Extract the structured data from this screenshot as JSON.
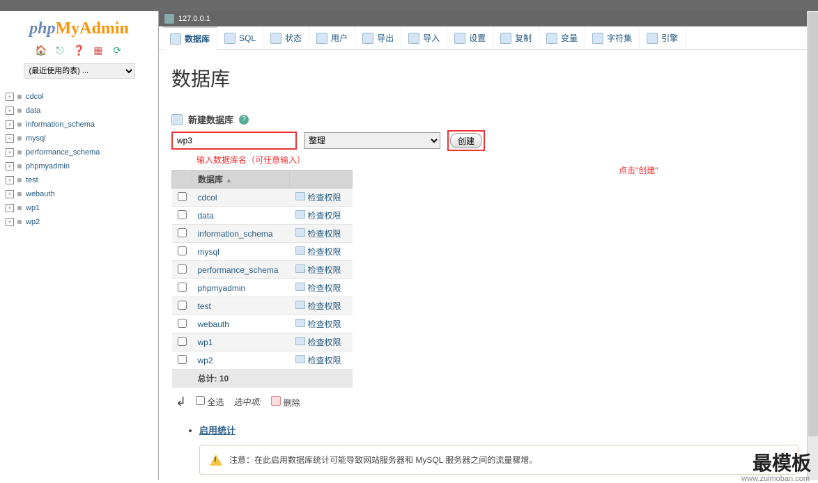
{
  "breadcrumb": {
    "server": "127.0.0.1"
  },
  "sidebar": {
    "recent_placeholder": "(最近使用的表) ...",
    "dbs": [
      "cdcol",
      "data",
      "information_schema",
      "mysql",
      "performance_schema",
      "phpmyadmin",
      "test",
      "webauth",
      "wp1",
      "wp2"
    ]
  },
  "tabs": [
    "数据库",
    "SQL",
    "状态",
    "用户",
    "导出",
    "导入",
    "设置",
    "复制",
    "变量",
    "字符集",
    "引擎"
  ],
  "page_title": "数据库",
  "create": {
    "label": "新建数据库",
    "input_value": "wp3",
    "collation_placeholder": "整理",
    "button": "创建"
  },
  "annotations": {
    "input": "输入数据库名（可任意输入）",
    "button": "点击\"创建\""
  },
  "table": {
    "header": {
      "db": "数据库"
    },
    "rows": [
      {
        "name": "cdcol",
        "action": "检查权限"
      },
      {
        "name": "data",
        "action": "检查权限"
      },
      {
        "name": "information_schema",
        "action": "检查权限"
      },
      {
        "name": "mysql",
        "action": "检查权限"
      },
      {
        "name": "performance_schema",
        "action": "检查权限"
      },
      {
        "name": "phpmyadmin",
        "action": "检查权限"
      },
      {
        "name": "test",
        "action": "检查权限"
      },
      {
        "name": "webauth",
        "action": "检查权限"
      },
      {
        "name": "wp1",
        "action": "检查权限"
      },
      {
        "name": "wp2",
        "action": "检查权限"
      }
    ],
    "total_label": "总计:",
    "total_value": "10"
  },
  "footer": {
    "check_all": "全选",
    "with_selected": "选中项:",
    "delete": "删除"
  },
  "stats": {
    "enable": "启用统计",
    "warning": "注意：在此启用数据库统计可能导致网站服务器和 MySQL 服务器之间的流量骤增。"
  },
  "watermark": {
    "main": "最模板",
    "sub": "www.zuimoban.com"
  }
}
